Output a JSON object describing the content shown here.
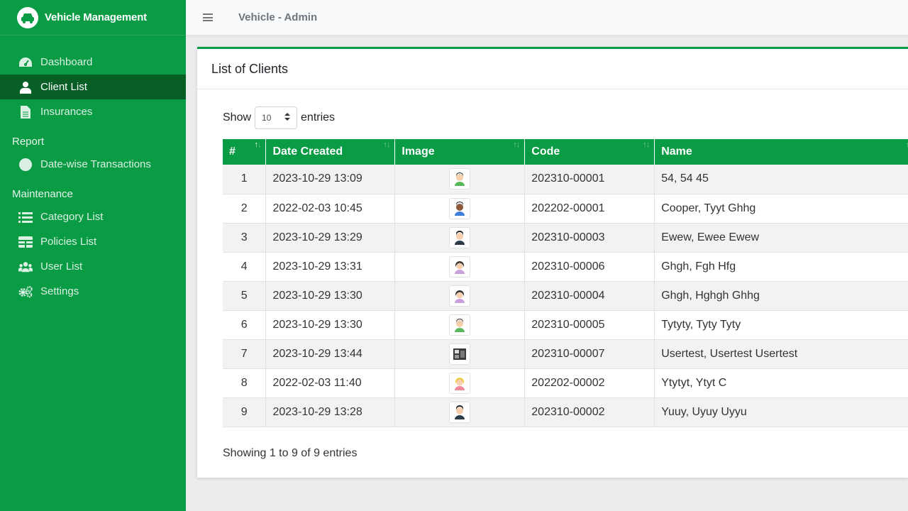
{
  "brand": {
    "title": "Vehicle Management"
  },
  "sidebar": {
    "items": [
      {
        "label": "Dashboard",
        "icon": "dashboard-icon",
        "active": false
      },
      {
        "label": "Client List",
        "icon": "user-icon",
        "active": true
      },
      {
        "label": "Insurances",
        "icon": "file-icon",
        "active": false
      }
    ],
    "report_header": "Report",
    "report_items": [
      {
        "label": "Date-wise Transactions",
        "icon": "circle-icon"
      }
    ],
    "maintenance_header": "Maintenance",
    "maintenance_items": [
      {
        "label": "Category List",
        "icon": "list-icon"
      },
      {
        "label": "Policies List",
        "icon": "table-icon"
      },
      {
        "label": "User List",
        "icon": "users-icon"
      },
      {
        "label": "Settings",
        "icon": "gears-icon"
      }
    ]
  },
  "topbar": {
    "title": "Vehicle - Admin"
  },
  "card": {
    "title": "List of Clients",
    "show_label": "Show",
    "entries_label": "entries",
    "page_length": "10",
    "info": "Showing 1 to 9 of 9 entries"
  },
  "table": {
    "columns": [
      "#",
      "Date Created",
      "Image",
      "Code",
      "Name"
    ],
    "rows": [
      {
        "num": "1",
        "date": "2023-10-29 13:09",
        "avatar": "male-green-avatar",
        "code": "202310-00001",
        "name": "54, 54 45"
      },
      {
        "num": "2",
        "date": "2022-02-03 10:45",
        "avatar": "male-blue-avatar",
        "code": "202202-00001",
        "name": "Cooper, Tyyt Ghhg"
      },
      {
        "num": "3",
        "date": "2023-10-29 13:29",
        "avatar": "male-dark-avatar",
        "code": "202310-00003",
        "name": "Ewew, Ewee Ewew"
      },
      {
        "num": "4",
        "date": "2023-10-29 13:31",
        "avatar": "female-avatar",
        "code": "202310-00006",
        "name": "Ghgh, Fgh Hfg"
      },
      {
        "num": "5",
        "date": "2023-10-29 13:30",
        "avatar": "female-avatar",
        "code": "202310-00004",
        "name": "Ghgh, Hghgh Ghhg"
      },
      {
        "num": "6",
        "date": "2023-10-29 13:30",
        "avatar": "male-green-avatar",
        "code": "202310-00005",
        "name": "Tytyty, Tyty Tyty"
      },
      {
        "num": "7",
        "date": "2023-10-29 13:44",
        "avatar": "photo-avatar",
        "code": "202310-00007",
        "name": "Usertest, Usertest Usertest"
      },
      {
        "num": "8",
        "date": "2022-02-03 11:40",
        "avatar": "female-blonde-avatar",
        "code": "202202-00002",
        "name": "Ytytyt, Ytyt C"
      },
      {
        "num": "9",
        "date": "2023-10-29 13:28",
        "avatar": "male-dark-avatar",
        "code": "202310-00002",
        "name": "Yuuy, Uyuy Uyyu"
      }
    ]
  },
  "colors": {
    "brand_green": "#0a9b45",
    "active_green": "#075f26"
  }
}
